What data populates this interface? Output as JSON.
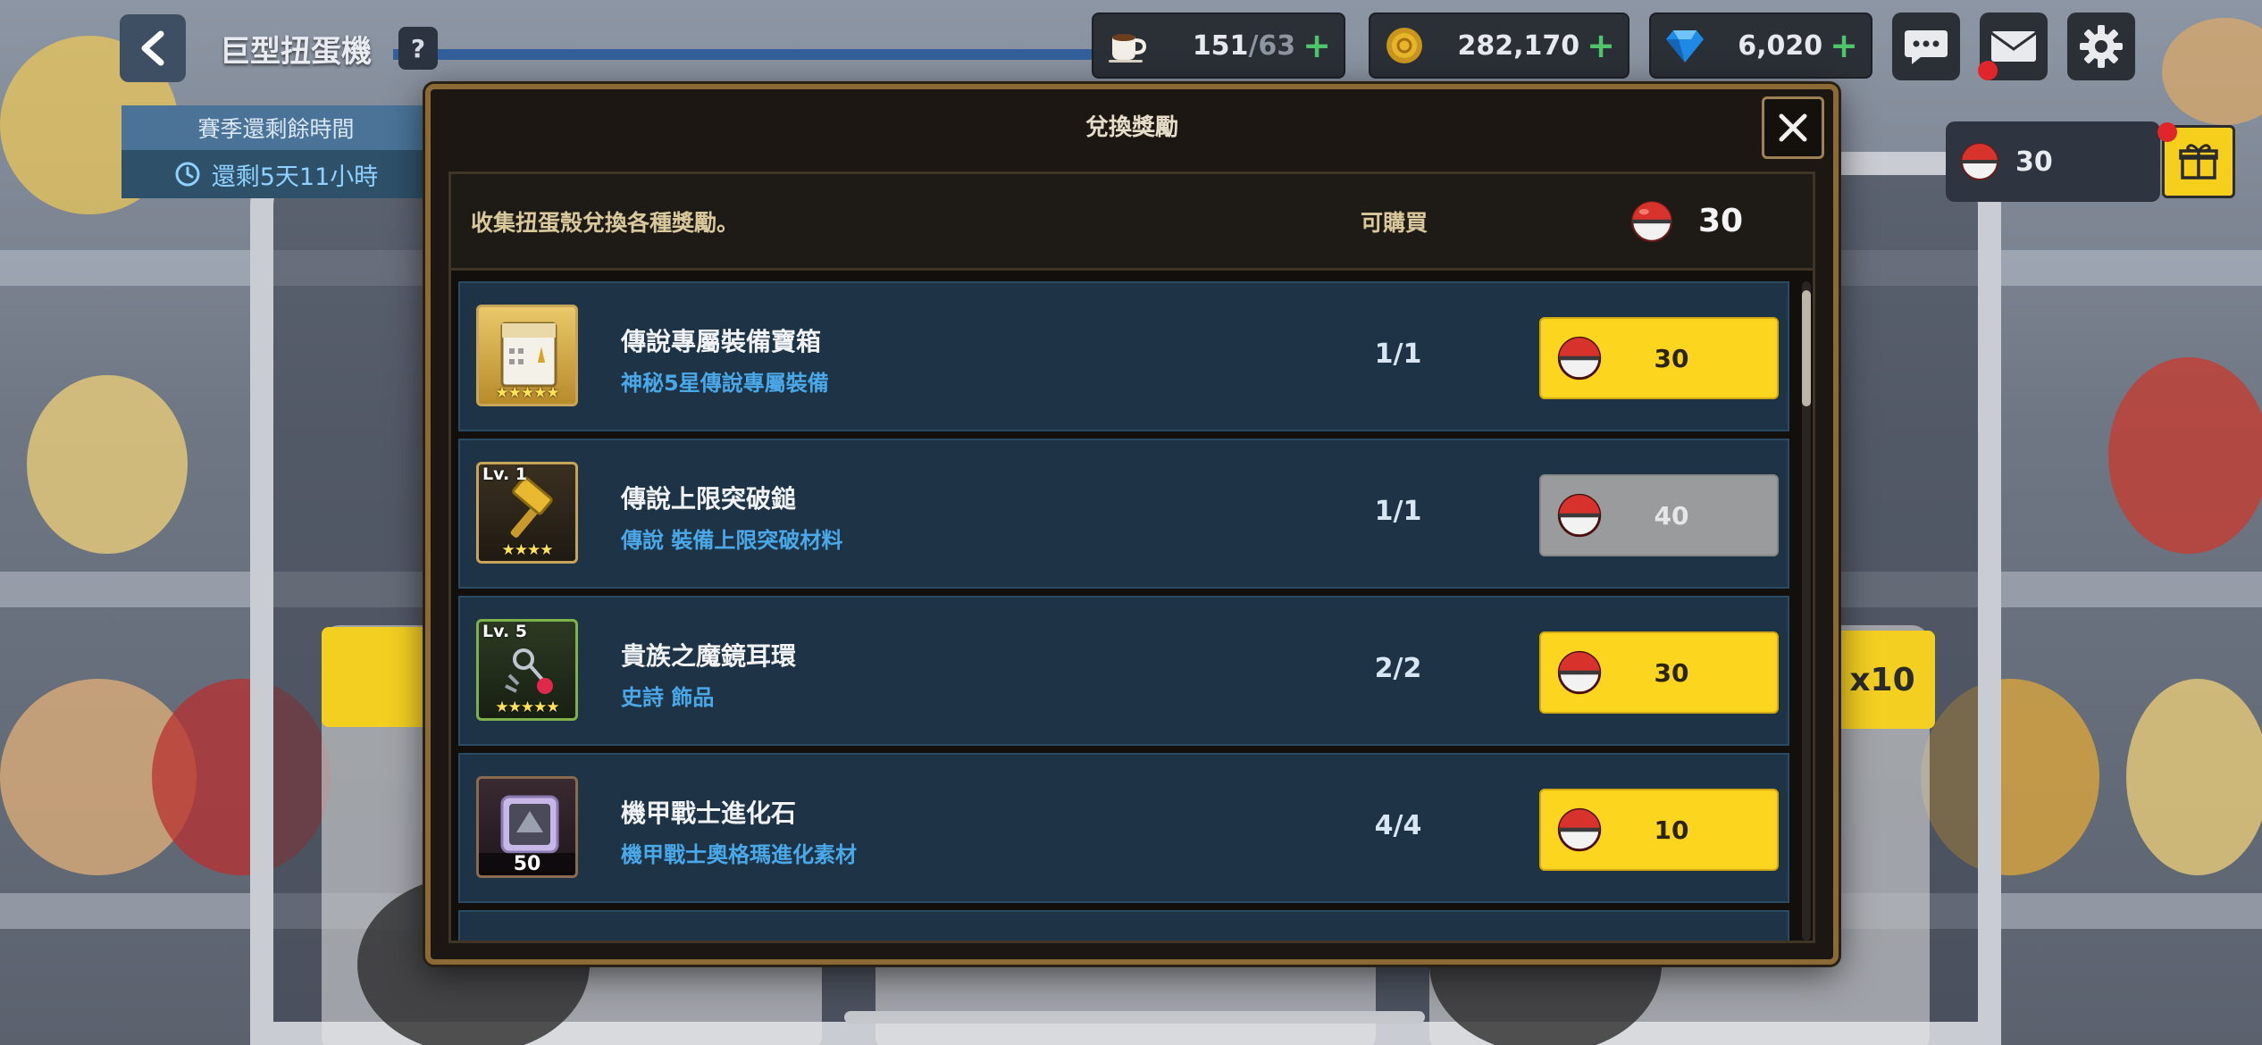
{
  "header": {
    "title": "巨型扭蛋機",
    "help_label": "?"
  },
  "resources": {
    "stamina": {
      "value": "151",
      "max": "/63",
      "icon": "coffee-cup-icon"
    },
    "gold": {
      "value": "282,170",
      "icon": "gold-coin-icon"
    },
    "gems": {
      "value": "6,020",
      "icon": "blue-gem-icon"
    },
    "plus": "+"
  },
  "season": {
    "label": "賽季還剩餘時間",
    "time_left": "還剩5天11小時"
  },
  "capsule_currency": {
    "value": "30"
  },
  "machine": {
    "multi_label": "x10"
  },
  "modal": {
    "title": "兌換獎勵",
    "info_text": "收集扭蛋殼兌換各種獎勵。",
    "available_label": "可購買",
    "owned_count": "30",
    "items": [
      {
        "name": "傳說專屬裝備寶箱",
        "desc": "神秘5星傳說專屬裝備",
        "limit": "1/1",
        "price": "30",
        "enabled": true,
        "stars": "★★★★★",
        "level": "",
        "qty": ""
      },
      {
        "name": "傳說上限突破鎚",
        "desc": "傳說  裝備上限突破材料",
        "limit": "1/1",
        "price": "40",
        "enabled": false,
        "stars": "★★★★",
        "level": "Lv. 1",
        "qty": ""
      },
      {
        "name": "貴族之魔鏡耳環",
        "desc": "史詩  飾品",
        "limit": "2/2",
        "price": "30",
        "enabled": true,
        "stars": "★★★★★",
        "level": "Lv. 5",
        "qty": ""
      },
      {
        "name": "機甲戰士進化石",
        "desc": "機甲戰士奧格瑪進化素材",
        "limit": "4/4",
        "price": "10",
        "enabled": true,
        "stars": "",
        "level": "",
        "qty": "50"
      }
    ]
  },
  "colors": {
    "buy_yellow": "#fbd51e",
    "buy_disabled": "#9a9b9d",
    "row_bg": "#1e3446",
    "desc_blue": "#4aa8e8",
    "modal_border": "#8b6a35"
  }
}
